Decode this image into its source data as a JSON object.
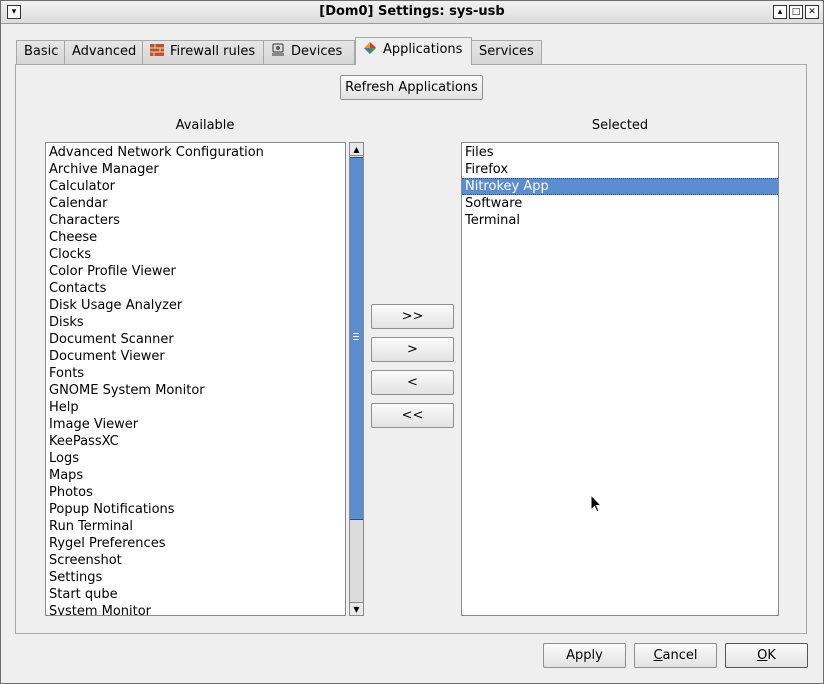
{
  "window": {
    "title": "[Dom0] Settings: sys-usb",
    "menu_glyph": "▾",
    "up_glyph": "▴",
    "max_glyph": "□",
    "close_glyph": "✕"
  },
  "tabs": [
    {
      "label": "Basic",
      "icon": ""
    },
    {
      "label": "Advanced",
      "icon": ""
    },
    {
      "label": "Firewall rules",
      "icon": "firewall-icon"
    },
    {
      "label": "Devices",
      "icon": "devices-icon"
    },
    {
      "label": "Applications",
      "icon": "applications-icon",
      "active": true
    },
    {
      "label": "Services",
      "icon": ""
    }
  ],
  "refresh_label": "Refresh Applications",
  "available": {
    "heading": "Available",
    "items": [
      "Advanced Network Configuration",
      "Archive Manager",
      "Calculator",
      "Calendar",
      "Characters",
      "Cheese",
      "Clocks",
      "Color Profile Viewer",
      "Contacts",
      "Disk Usage Analyzer",
      "Disks",
      "Document Scanner",
      "Document Viewer",
      "Fonts",
      "GNOME System Monitor",
      "Help",
      "Image Viewer",
      "KeePassXC",
      "Logs",
      "Maps",
      "Photos",
      "Popup Notifications",
      "Run Terminal",
      "Rygel Preferences",
      "Screenshot",
      "Settings",
      "Start qube",
      "System Monitor"
    ]
  },
  "selected": {
    "heading": "Selected",
    "items": [
      "Files",
      "Firefox",
      "Nitrokey App",
      "Software",
      "Terminal"
    ],
    "highlighted": "Nitrokey App"
  },
  "transfer": {
    "add_all": ">>",
    "add": ">",
    "remove": "<",
    "remove_all": "<<"
  },
  "scroll_glyphs": {
    "up": "▲",
    "down": "▼"
  },
  "footer": {
    "apply": "Apply",
    "cancel_first": "C",
    "cancel_rest": "ancel",
    "ok_first": "O",
    "ok_rest": "K"
  },
  "colors": {
    "selection": "#5b8dd0",
    "background": "#efefef"
  }
}
